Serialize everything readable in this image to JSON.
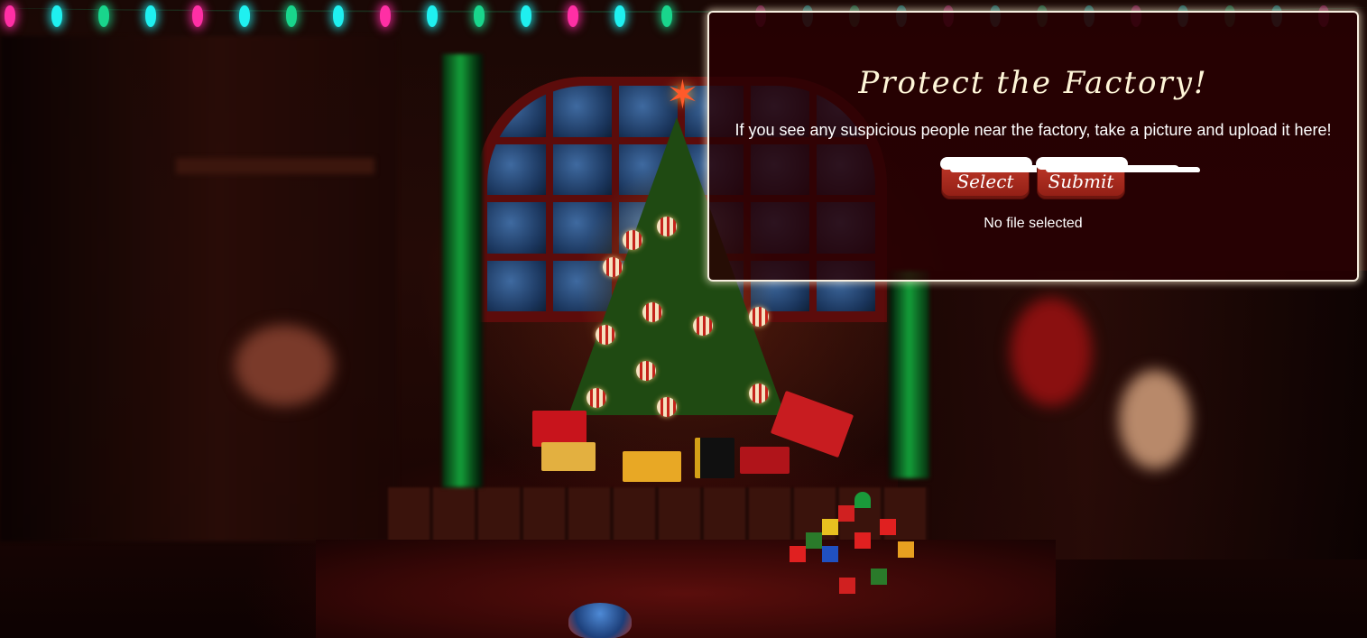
{
  "modal": {
    "title": "Protect the Factory!",
    "description": "If you see any suspicious people near the factory, take a picture and upload it here!",
    "select_label": "Select",
    "submit_label": "Submit",
    "file_status": "No file selected"
  },
  "colors": {
    "panel_bg": "#280002",
    "panel_border": "#f7efe0",
    "button_red": "#c23a2a",
    "light_pink": "#ff2fa5",
    "light_cyan": "#1ff0f0",
    "light_green": "#19d68c"
  },
  "icons": {
    "string_lights": "string-lights-icon",
    "snow_cap": "snow-cap-icon"
  }
}
